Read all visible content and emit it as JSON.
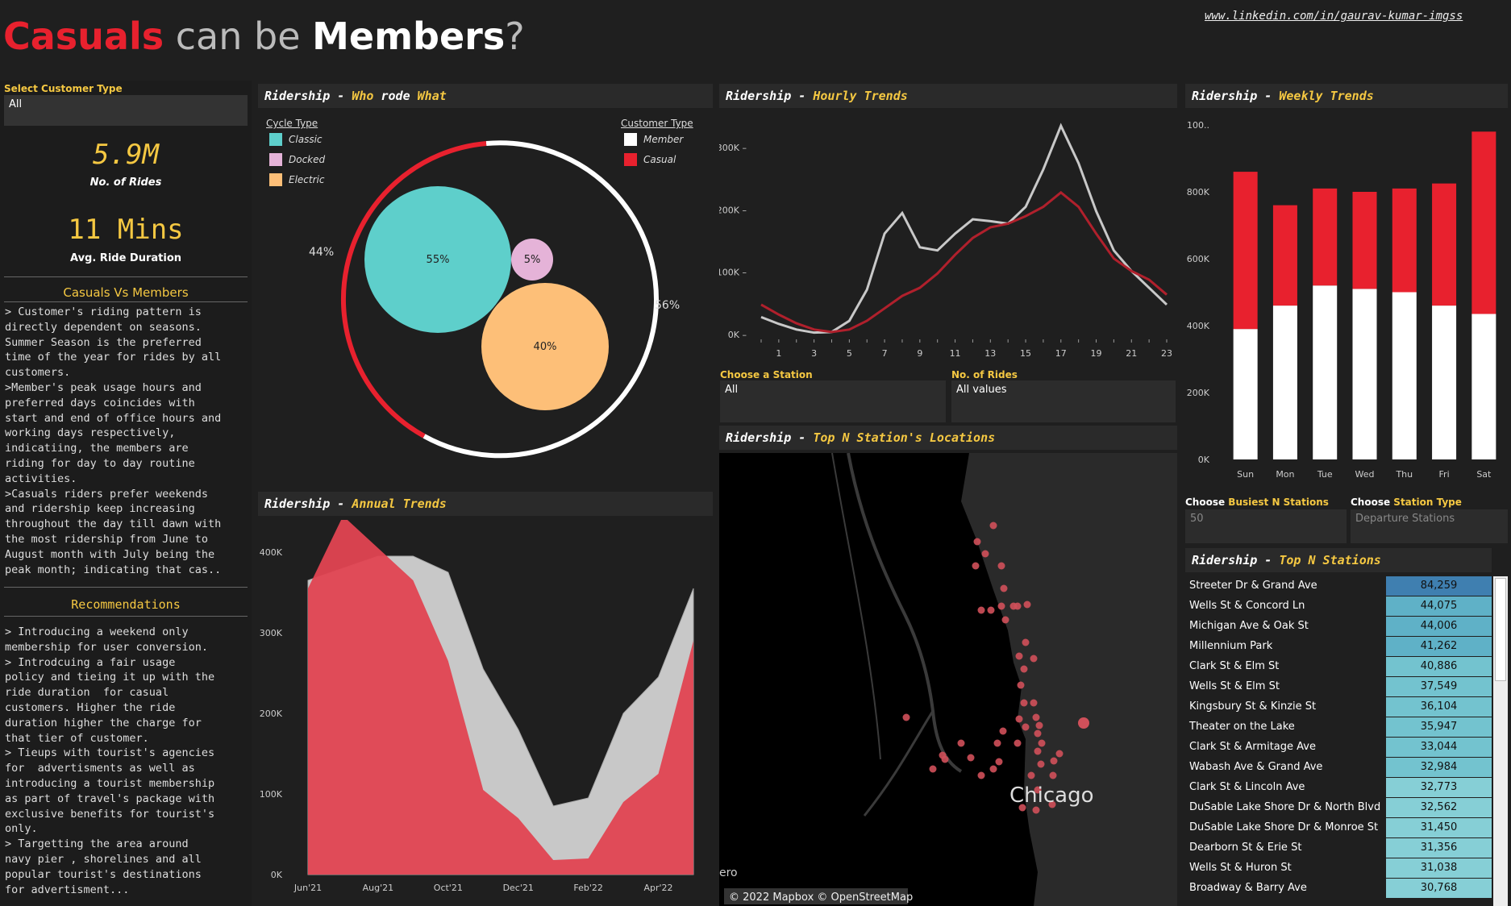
{
  "header": {
    "title_part1": "Casuals",
    "title_part2": " can be ",
    "title_part3": "Members",
    "title_part4": "?",
    "link": "www.linkedin.com/in/gaurav-kumar-imgss"
  },
  "sidebar": {
    "filter_label": "Select Customer Type",
    "filter_value": "All",
    "kpi1_value": "5.9M",
    "kpi1_label": "No. of Rides",
    "kpi2_value": "11 Mins",
    "kpi2_label": "Avg. Ride Duration",
    "section1_title": "Casuals Vs Members",
    "section1_text": "> Customer's riding pattern is\ndirectly dependent on seasons.\nSummer Season is the preferred\ntime of the year for rides by all\ncustomers.\n>Member's peak usage hours and\npreferred days coincides with\nstart and end of office hours and\nworking days respectively,\nindicatiing, the members are\nriding for day to day routine\nactivities.\n>Casuals riders prefer weekends\nand ridership keep increasing\nthroughout the day till dawn with\nthe most ridership from June to\nAugust month with July being the\npeak month; indicating that cas..",
    "section2_title": "Recommendations",
    "section2_text": "> Introducing a weekend only\nmembership for user conversion.\n> Introdcuing a fair usage\npolicy and tieing it up with the\nride duration  for casual\ncustomers. Higher the ride\nduration higher the charge for\nthat tier of customer.\n> Tieups with tourist's agencies\nfor  advertisments as well as\nintroducing a tourist membership\nas part of travel's package with\nexclusive benefits for tourist's\nonly.\n> Targetting the area around\nnavy pier , shorelines and all\npopular tourist's destinations\nfor advertisment..."
  },
  "panels": {
    "who_prefix": "Ridership - ",
    "who_hl": "Who",
    "who_mid": " rode ",
    "who_hl2": "What",
    "hourly_prefix": "Ridership - ",
    "hourly_hl": "Hourly Trends",
    "weekly_prefix": "Ridership - ",
    "weekly_hl": "Weekly Trends",
    "annual_prefix": "Ridership - ",
    "annual_hl": "Annual Trends",
    "map_prefix": "Ridership - ",
    "map_hl": "Top N Station's Locations",
    "topn_prefix": "Ridership - ",
    "topn_hl": "Top N Stations"
  },
  "bubble": {
    "cycle_legend_title": "Cycle Type",
    "cycle_types": [
      "Classic",
      "Docked",
      "Electric"
    ],
    "customer_legend_title": "Customer Type",
    "customer_types": [
      "Member",
      "Casual"
    ],
    "bubble_classic": "55%",
    "bubble_docked": "5%",
    "bubble_electric": "40%",
    "ring_casual": "44%",
    "ring_member": "56%",
    "colors": {
      "classic": "#5ecfcb",
      "docked": "#e5b3d8",
      "electric": "#fdbf78",
      "member": "#ffffff",
      "casual": "#e8212e"
    }
  },
  "filters": {
    "station_label": "Choose a Station",
    "station_value": "All",
    "rides_label": "No. of Rides",
    "rides_value": "All values",
    "busiest_label_a": "Choose ",
    "busiest_label_b": "Busiest N Stations",
    "busiest_value": "50",
    "stationtype_label_a": "Choose ",
    "stationtype_label_b": "Station Type",
    "stationtype_value": "Departure Stations"
  },
  "map": {
    "city_label": "Chicago",
    "credit": "© 2022 Mapbox © OpenStreetMap",
    "edge_text": "ero"
  },
  "chart_data": [
    {
      "type": "line",
      "id": "hourly",
      "x": [
        0,
        1,
        2,
        3,
        4,
        5,
        6,
        7,
        8,
        9,
        10,
        11,
        12,
        13,
        14,
        15,
        16,
        17,
        18,
        19,
        20,
        21,
        22,
        23
      ],
      "xticks": [
        "1",
        "3",
        "5",
        "7",
        "9",
        "11",
        "13",
        "15",
        "17",
        "19",
        "21",
        "23"
      ],
      "yticks": [
        "0K",
        "100K",
        "200K",
        "300K"
      ],
      "ylim": [
        0,
        330000
      ],
      "series": [
        {
          "name": "Member",
          "color": "#c8c8c8",
          "values": [
            28000,
            17000,
            8000,
            3000,
            4000,
            22000,
            72000,
            162000,
            195000,
            140000,
            135000,
            162000,
            185000,
            182000,
            178000,
            205000,
            265000,
            335000,
            275000,
            198000,
            135000,
            102000,
            75000,
            48000
          ]
        },
        {
          "name": "Casual",
          "color": "#b0202c",
          "values": [
            48000,
            32000,
            18000,
            8000,
            4000,
            8000,
            22000,
            42000,
            62000,
            75000,
            98000,
            128000,
            155000,
            172000,
            178000,
            190000,
            205000,
            228000,
            205000,
            162000,
            122000,
            102000,
            88000,
            64000
          ]
        }
      ]
    },
    {
      "type": "bar",
      "id": "weekly",
      "categories": [
        "Sun",
        "Mon",
        "Tue",
        "Wed",
        "Thu",
        "Fri",
        "Sat"
      ],
      "yticks": [
        "0K",
        "200K",
        "400K",
        "600K",
        "800K",
        "100.."
      ],
      "ylim": [
        0,
        1000000
      ],
      "series": [
        {
          "name": "Member",
          "color": "#ffffff",
          "values": [
            390000,
            460000,
            520000,
            510000,
            500000,
            460000,
            435000
          ]
        },
        {
          "name": "Casual",
          "color": "#e8212e",
          "values": [
            470000,
            300000,
            290000,
            290000,
            310000,
            365000,
            545000
          ]
        }
      ]
    },
    {
      "type": "area",
      "id": "annual",
      "x": [
        "Jun'21",
        "Jul'21",
        "Aug'21",
        "Sep'21",
        "Oct'21",
        "Nov'21",
        "Dec'21",
        "Jan'22",
        "Feb'22",
        "Mar'22",
        "Apr'22",
        "May'22"
      ],
      "xticks": [
        "Jun'21",
        "Aug'21",
        "Oct'21",
        "Dec'21",
        "Feb'22",
        "Apr'22"
      ],
      "yticks": [
        "0K",
        "100K",
        "200K",
        "300K",
        "400K"
      ],
      "ylim": [
        0,
        420000
      ],
      "series": [
        {
          "name": "Member",
          "color": "#c8c8c8",
          "values": [
            365000,
            380000,
            395000,
            395000,
            375000,
            255000,
            180000,
            85000,
            95000,
            200000,
            245000,
            355000
          ]
        },
        {
          "name": "Casual",
          "color": "#e14552",
          "values": [
            355000,
            445000,
            405000,
            365000,
            265000,
            105000,
            70000,
            18000,
            20000,
            90000,
            125000,
            290000
          ]
        }
      ]
    }
  ],
  "top_stations": [
    {
      "name": "Streeter Dr & Grand Ave",
      "value": "84,259"
    },
    {
      "name": "Wells St & Concord Ln",
      "value": "44,075"
    },
    {
      "name": "Michigan Ave & Oak St",
      "value": "44,006"
    },
    {
      "name": "Millennium Park",
      "value": "41,262"
    },
    {
      "name": "Clark St & Elm St",
      "value": "40,886"
    },
    {
      "name": "Wells St & Elm St",
      "value": "37,549"
    },
    {
      "name": "Kingsbury St & Kinzie St",
      "value": "36,104"
    },
    {
      "name": "Theater on the Lake",
      "value": "35,947"
    },
    {
      "name": "Clark St & Armitage Ave",
      "value": "33,044"
    },
    {
      "name": "Wabash Ave & Grand Ave",
      "value": "32,984"
    },
    {
      "name": "Clark St & Lincoln Ave",
      "value": "32,773"
    },
    {
      "name": "DuSable Lake Shore Dr & North Blvd",
      "value": "32,562"
    },
    {
      "name": "DuSable Lake Shore Dr & Monroe St",
      "value": "31,450"
    },
    {
      "name": "Dearborn St & Erie St",
      "value": "31,356"
    },
    {
      "name": "Wells St & Huron St",
      "value": "31,038"
    },
    {
      "name": "Broadway & Barry Ave",
      "value": "30,768"
    }
  ]
}
